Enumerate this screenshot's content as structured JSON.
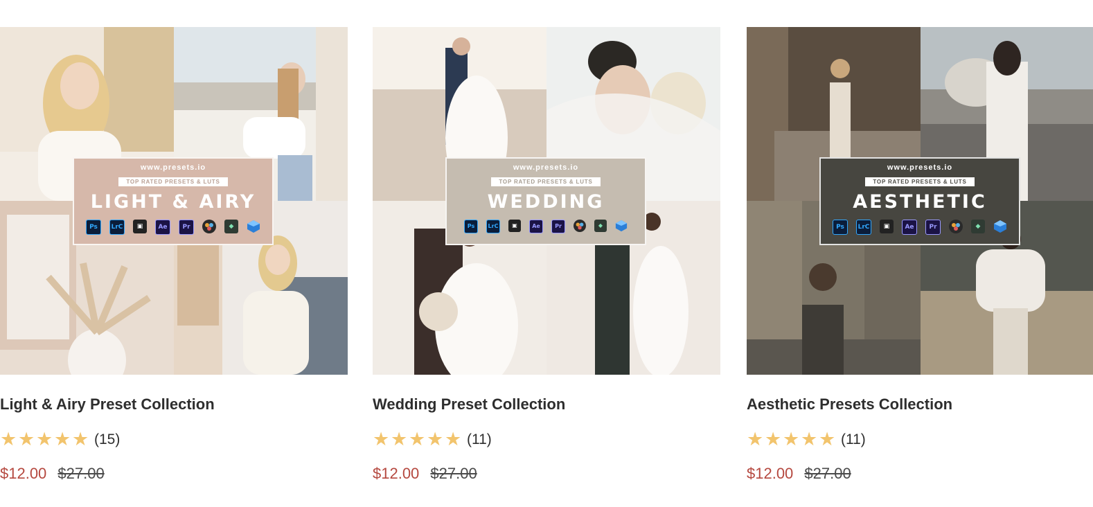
{
  "products": [
    {
      "name": "Light & Airy Preset Collection",
      "banner": {
        "url": "www.presets.io",
        "tagline": "TOP RATED PRESETS & LUTS",
        "title": "LIGHT & AIRY",
        "bg": "#d6b8aa",
        "tag_color": "#b99f93"
      },
      "rating": {
        "stars": 5,
        "count": "(15)"
      },
      "price": {
        "sale": "$12.00",
        "original": "$27.00"
      }
    },
    {
      "name": "Wedding Preset Collection",
      "banner": {
        "url": "www.presets.io",
        "tagline": "TOP RATED PRESETS & LUTS",
        "title": "WEDDING",
        "bg": "#c5bcb0",
        "tag_color": "#a79e92"
      },
      "rating": {
        "stars": 5,
        "count": "(11)"
      },
      "price": {
        "sale": "$12.00",
        "original": "$27.00"
      }
    },
    {
      "name": "Aesthetic Presets Collection",
      "banner": {
        "url": "www.presets.io",
        "tagline": "TOP RATED PRESETS & LUTS",
        "title": "AESTHETIC",
        "bg": "#474640",
        "tag_color": "#4a4943"
      },
      "rating": {
        "stars": 5,
        "count": "(11)"
      },
      "price": {
        "sale": "$12.00",
        "original": "$27.00"
      }
    }
  ],
  "app_icons": [
    {
      "label": "Ps",
      "icon": "photoshop-icon"
    },
    {
      "label": "LrC",
      "icon": "lightroom-classic-icon"
    },
    {
      "label": "",
      "icon": "final-cut-pro-icon"
    },
    {
      "label": "Ae",
      "icon": "after-effects-icon"
    },
    {
      "label": "Pr",
      "icon": "premiere-pro-icon"
    },
    {
      "label": "",
      "icon": "davinci-resolve-icon"
    },
    {
      "label": "",
      "icon": "filmora-icon"
    },
    {
      "label": "",
      "icon": "lut-cube-icon"
    }
  ],
  "colors": {
    "star": "#f2c46d",
    "sale_price": "#b5483f",
    "text": "#2e2e2e"
  }
}
